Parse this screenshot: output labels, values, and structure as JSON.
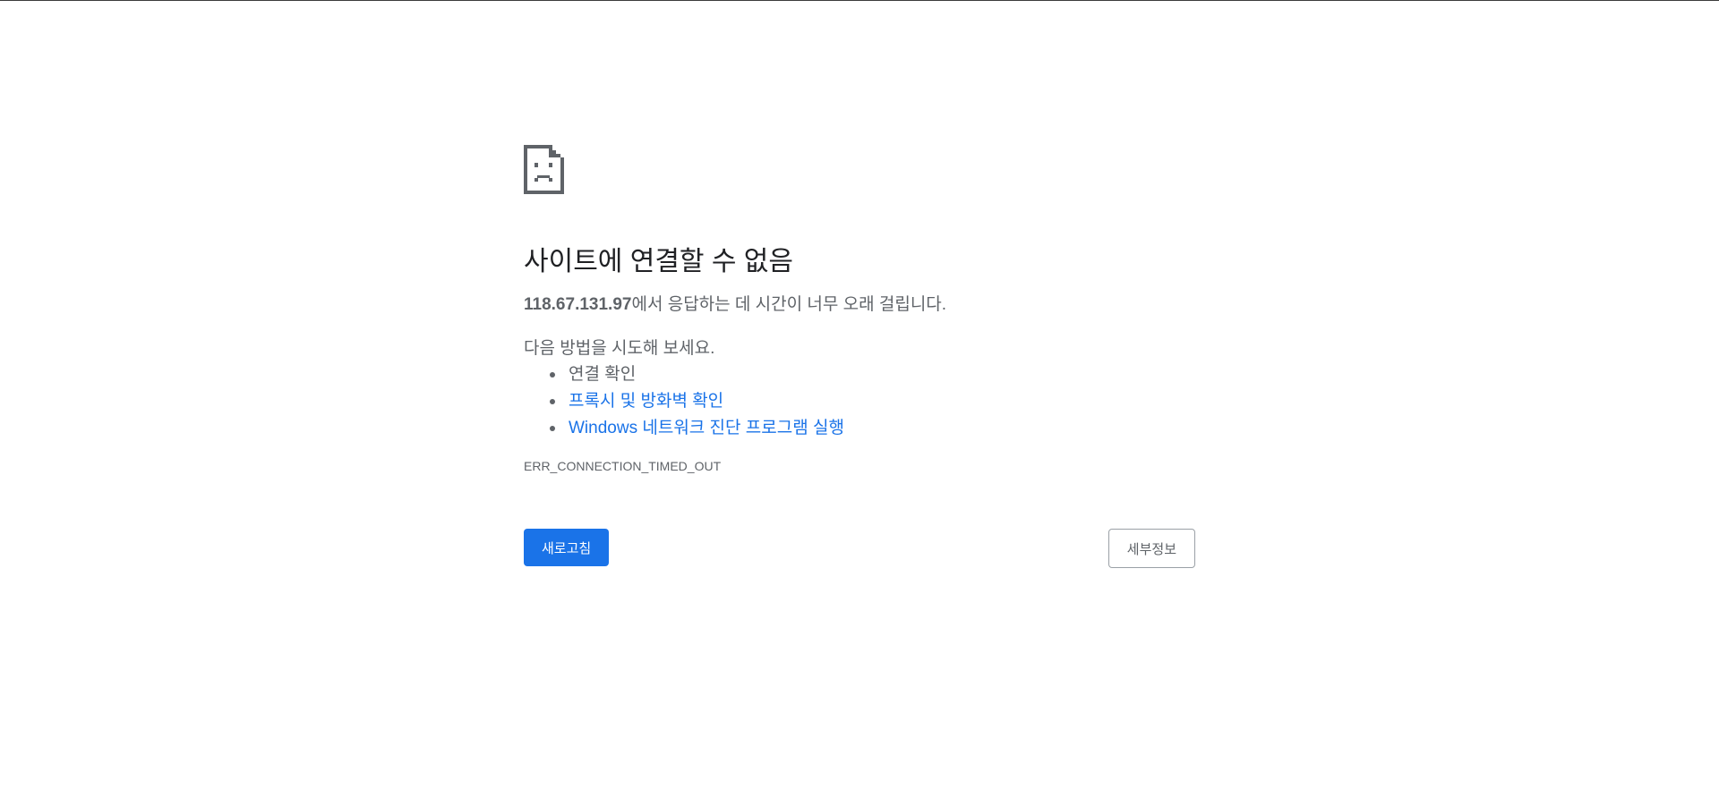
{
  "error": {
    "title": "사이트에 연결할 수 없음",
    "host": "118.67.131.97",
    "summary_suffix": "에서 응답하는 데 시간이 너무 오래 걸립니다.",
    "suggest_heading": "다음 방법을 시도해 보세요.",
    "suggestions": [
      {
        "label": "연결 확인",
        "link": false
      },
      {
        "label": "프록시 및 방화벽 확인",
        "link": true
      },
      {
        "label": "Windows 네트워크 진단 프로그램 실행",
        "link": true
      }
    ],
    "code": "ERR_CONNECTION_TIMED_OUT",
    "icon": "sad-page-icon"
  },
  "buttons": {
    "reload_label": "새로고침",
    "details_label": "세부정보"
  },
  "colors": {
    "accent": "#1a73e8",
    "text_primary": "#202124",
    "text_secondary": "#5f6368"
  }
}
